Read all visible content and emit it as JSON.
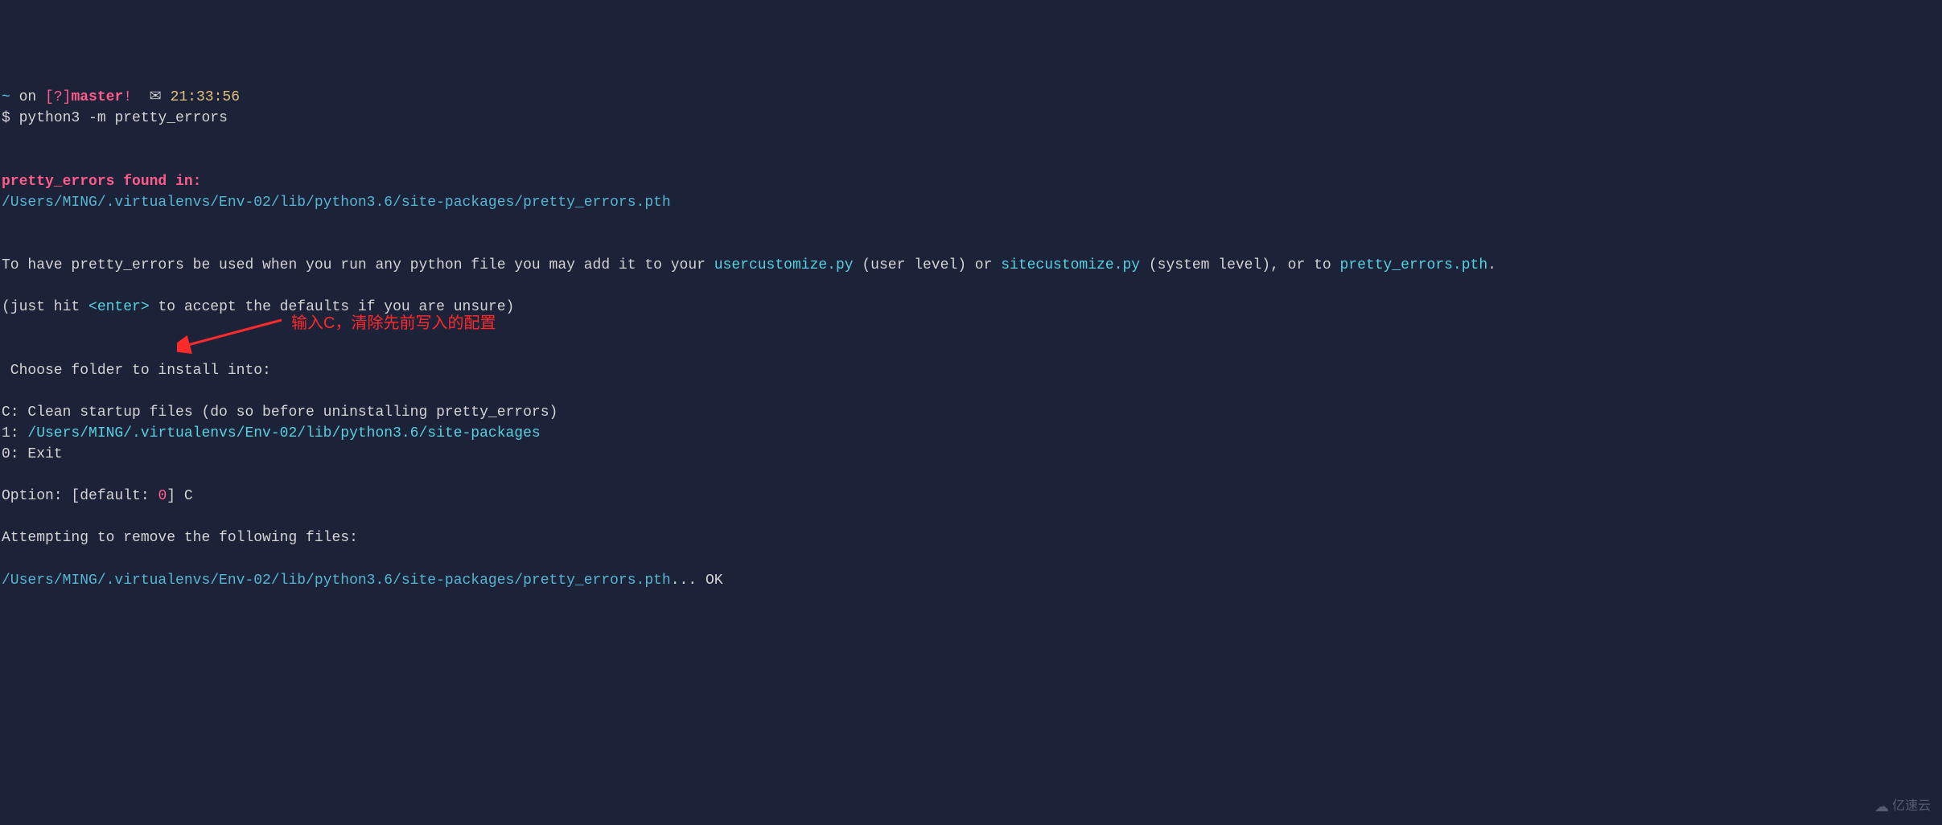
{
  "prompt": {
    "tilde": "~",
    "on": " on ",
    "branch_open": "[?]",
    "branch_name": "master",
    "branch_bang": "!",
    "clock": "✉",
    "time": "21:33:56",
    "dollar": "$",
    "command": "python3 -m pretty_errors"
  },
  "found": {
    "header": "pretty_errors found in:",
    "path": "/Users/MING/.virtualenvs/Env-02/lib/python3.6/site-packages/pretty_errors.pth"
  },
  "instruction": {
    "prefix": "To have pretty_errors be used when you run any python file you may add it to your ",
    "usercustomize": "usercustomize.py",
    "mid1": " (user level) or ",
    "sitecustomize": "sitecustomize.py",
    "mid2": " (system level), or to ",
    "pth": "pretty_errors.pth",
    "suffix": "."
  },
  "hint": {
    "prefix": "(just hit ",
    "enter": "<enter>",
    "suffix": " to accept the defaults if you are unsure)"
  },
  "choose_prompt": " Choose folder to install into:",
  "options": {
    "c": "C: Clean startup files (do so before uninstalling pretty_errors)",
    "one_label": "1: ",
    "one_path": "/Users/MING/.virtualenvs/Env-02/lib/python3.6/site-packages",
    "zero": "0: Exit"
  },
  "option_line": {
    "prefix": "Option: [default: ",
    "default": "0",
    "suffix": "] C"
  },
  "attempting": "Attempting to remove the following files:",
  "remove": {
    "path": "/Users/MING/.virtualenvs/Env-02/lib/python3.6/site-packages/pretty_errors.pth",
    "dots": "... ",
    "ok": "OK"
  },
  "annotation": "输入C，清除先前写入的配置",
  "watermark": "亿速云"
}
